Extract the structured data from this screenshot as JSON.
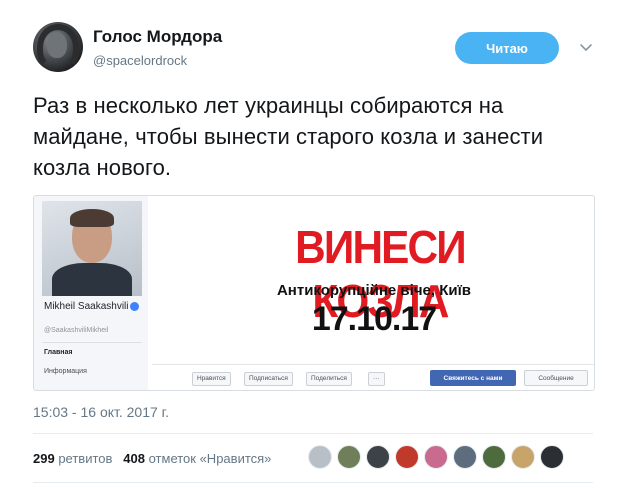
{
  "account": {
    "name": "Голос Мордора",
    "handle": "@spacelordrock"
  },
  "follow_button": {
    "label": "Читаю"
  },
  "tweet": {
    "text": "Раз в несколько лет украинцы собираются на майдане, чтобы вынести старого козла и занести козла нового.",
    "timestamp": "15:03 - 16 окт. 2017 г."
  },
  "media": {
    "fb_profile": {
      "name": "Mikheil Saakashvili",
      "handle": "@SaakashviliMikheil",
      "nav": [
        "Главная",
        "Информация"
      ]
    },
    "cover": {
      "headline": "ВИНЕСИ КОЗЛА",
      "subline": "Антикорупційне віче, Київ",
      "date": "17.10.17"
    },
    "fb_actions": {
      "like": "Нравится",
      "follow": "Подписаться",
      "share": "Поделиться",
      "more": "···",
      "contact": "Свяжитесь с нами",
      "message": "Сообщение"
    }
  },
  "stats": {
    "retweets_count": "299",
    "retweets_label": "ретвитов",
    "likes_count": "408",
    "likes_label": "отметок «Нравится»"
  },
  "likers": {
    "colors": [
      "#b9bfc6",
      "#6e7f5a",
      "#3d4248",
      "#c0392b",
      "#c86b8e",
      "#5d6d7e",
      "#4d6b3c",
      "#c8a46a",
      "#2b2f33"
    ]
  }
}
